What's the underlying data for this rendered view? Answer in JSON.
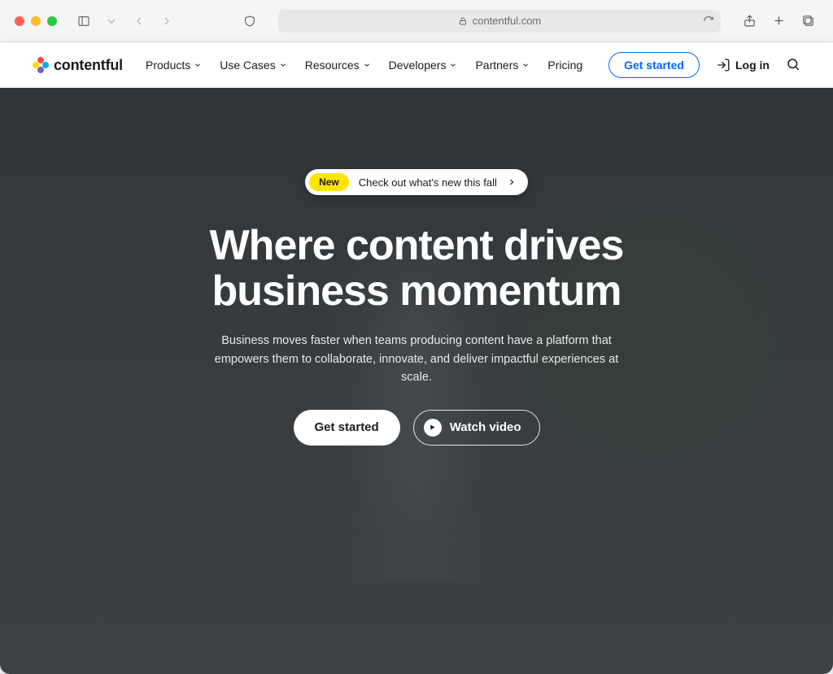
{
  "browser": {
    "url_host": "contentful.com"
  },
  "header": {
    "brand": "contentful",
    "nav": [
      {
        "label": "Products",
        "has_menu": true
      },
      {
        "label": "Use Cases",
        "has_menu": true
      },
      {
        "label": "Resources",
        "has_menu": true
      },
      {
        "label": "Developers",
        "has_menu": true
      },
      {
        "label": "Partners",
        "has_menu": true
      },
      {
        "label": "Pricing",
        "has_menu": false
      }
    ],
    "cta": "Get started",
    "login": "Log in"
  },
  "hero": {
    "pill_badge": "New",
    "pill_text": "Check out what's new this fall",
    "title_line1": "Where content drives",
    "title_line2": "business momentum",
    "subtitle": "Business moves faster when teams producing content have a platform that empowers them to collaborate, innovate, and deliver impactful experiences at scale.",
    "primary_cta": "Get started",
    "secondary_cta": "Watch video"
  }
}
